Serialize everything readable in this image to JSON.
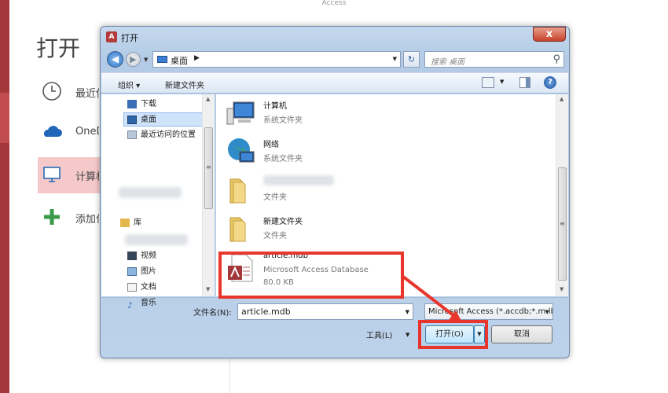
{
  "app": {
    "title": "Access",
    "heading": "打开"
  },
  "backstage": {
    "items": [
      {
        "label": "最近使用的",
        "icon": "clock-icon"
      },
      {
        "label": "OneDrive",
        "icon": "cloud-icon"
      },
      {
        "label": "计算机",
        "icon": "computer-icon"
      },
      {
        "label": "添加位置",
        "icon": "plus-icon"
      }
    ]
  },
  "dialog": {
    "title": "打开",
    "close_label": "x",
    "address": {
      "location": "桌面",
      "separator": "▶"
    },
    "search_placeholder": "搜索 桌面",
    "toolbar": {
      "organize_label": "组织 ▾",
      "new_folder_label": "新建文件夹"
    },
    "nav": {
      "items": [
        {
          "label": "下载"
        },
        {
          "label": "桌面"
        },
        {
          "label": "最近访问的位置"
        },
        {
          "label": "库"
        },
        {
          "label": "视频"
        },
        {
          "label": "图片"
        },
        {
          "label": "文档"
        },
        {
          "label": "音乐"
        }
      ]
    },
    "files": [
      {
        "name": "计算机",
        "type": "系统文件夹",
        "icon": "computer-icon"
      },
      {
        "name": "网络",
        "type": "系统文件夹",
        "icon": "network-globe-icon"
      },
      {
        "name": "",
        "type": "文件夹",
        "icon": "folder-icon"
      },
      {
        "name": "新建文件夹",
        "type": "文件夹",
        "icon": "folder-icon"
      },
      {
        "name": "article.mdb",
        "type": "Microsoft Access Database",
        "size": "80.0 KB",
        "icon": "access-database-icon"
      }
    ],
    "filename_label": "文件名(N):",
    "filename_value": "article.mdb",
    "filetype_value": "Microsoft Access (*.accdb;*.mdb)",
    "tools_label": "工具(L)",
    "open_label": "打开(O)",
    "cancel_label": "取消"
  },
  "colors": {
    "highlight": "#e8362c",
    "access_brand": "#a4373a"
  }
}
